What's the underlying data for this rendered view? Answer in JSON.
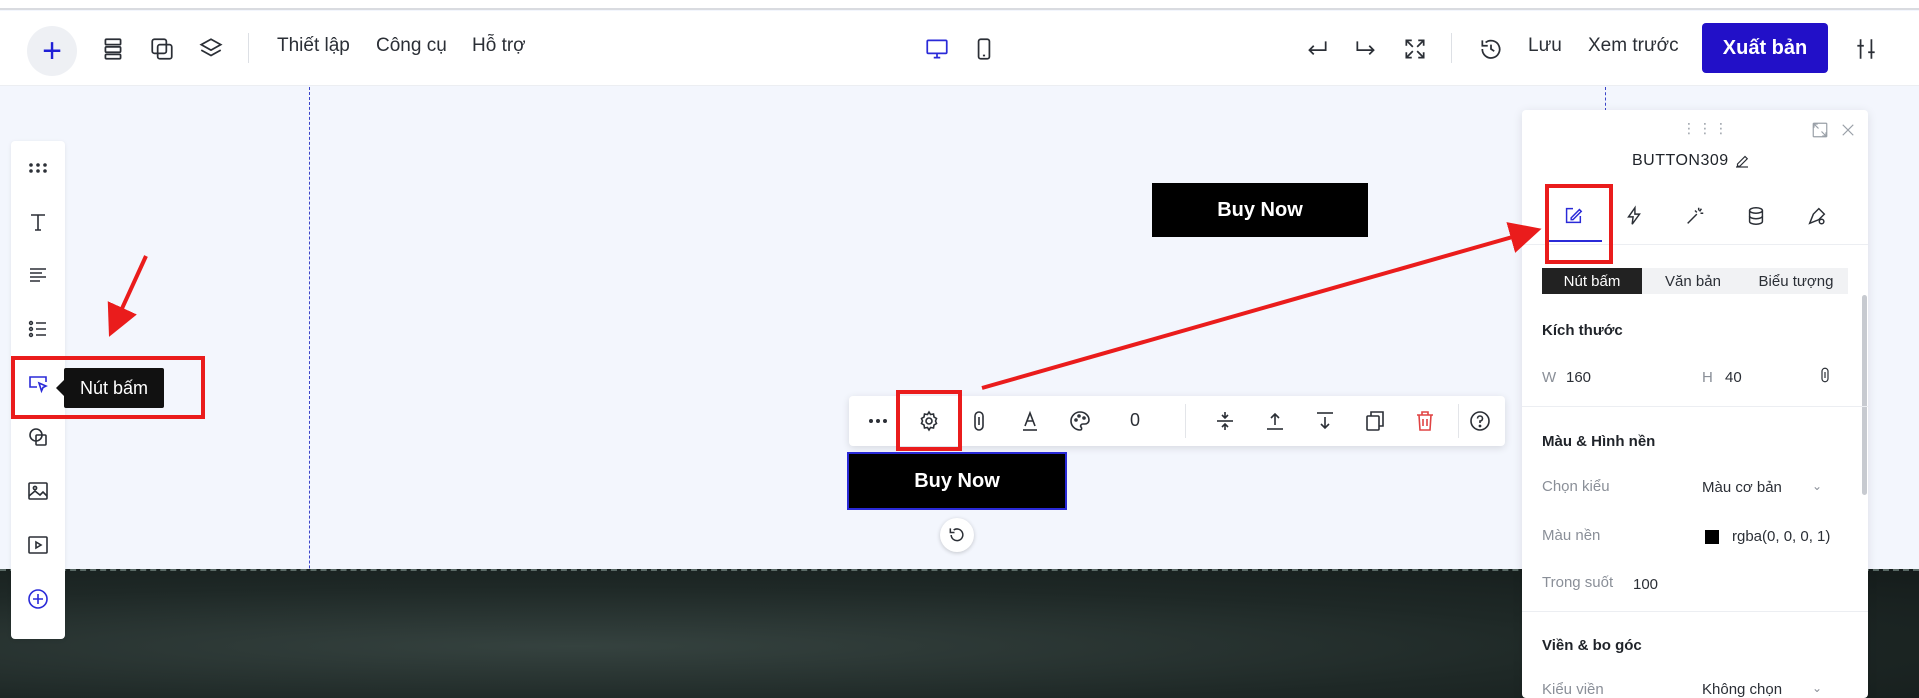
{
  "topbar": {
    "menu": [
      "Thiết lập",
      "Công cụ",
      "Hỗ trợ"
    ],
    "save_label": "Lưu",
    "preview_label": "Xem trước",
    "publish_label": "Xuất bản"
  },
  "left_toolbar": {
    "tooltip": "Nút bấm"
  },
  "canvas": {
    "button_top_label": "Buy Now",
    "button_selected_label": "Buy Now"
  },
  "element_toolbar": {
    "rotation_value": "0"
  },
  "panel": {
    "element_name": "BUTTON309",
    "segments": [
      "Nút bấm",
      "Văn bản",
      "Biểu tượng"
    ],
    "size": {
      "title": "Kích thước",
      "w_label": "W",
      "w_value": "160",
      "h_label": "H",
      "h_value": "40"
    },
    "color": {
      "title": "Màu & Hình nền",
      "style_label": "Chọn kiểu",
      "style_value": "Màu cơ bản",
      "bg_label": "Màu nền",
      "bg_value": "rgba(0, 0, 0, 1)",
      "opacity_label": "Trong suốt",
      "opacity_value": "100"
    },
    "border": {
      "title": "Viền & bo góc",
      "style_label": "Kiểu viền",
      "style_value": "Không chọn"
    }
  },
  "colors": {
    "accent": "#2210c8",
    "annotation": "#ea1c1c"
  }
}
